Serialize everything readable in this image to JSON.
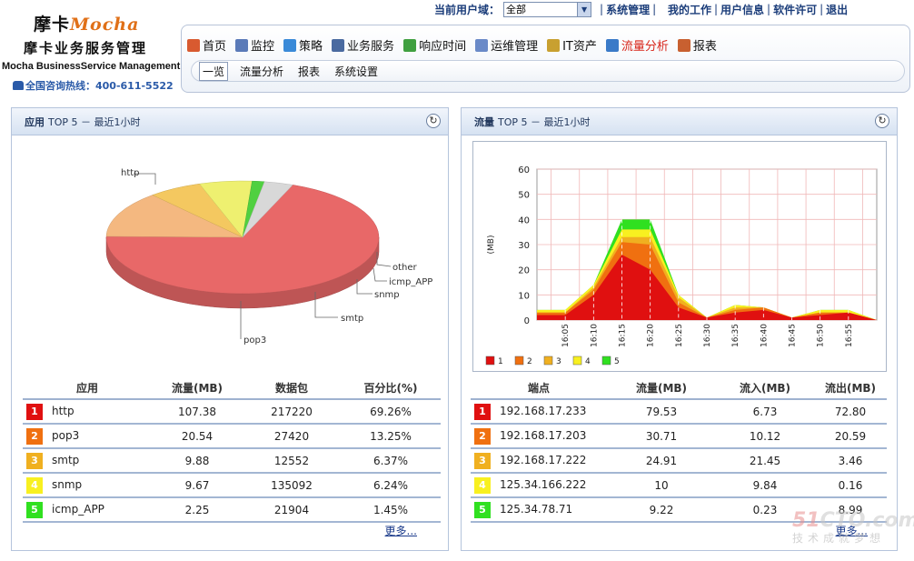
{
  "header": {
    "brand_cn": "摩卡",
    "brand_en": "Mocha",
    "product_cn": "摩卡业务服务管理",
    "product_en": "Mocha BusinessService Management",
    "hotline": "全国咨询热线：400-611-5522"
  },
  "userbar": {
    "domain_label": "当前用户域：",
    "domain_value": "全部",
    "links": [
      "系统管理",
      "我的工作",
      "用户信息",
      "软件许可",
      "退出"
    ]
  },
  "main_nav": [
    {
      "label": "首页",
      "icon": "home-icon"
    },
    {
      "label": "监控",
      "icon": "monitor-icon"
    },
    {
      "label": "策略",
      "icon": "policy-icon"
    },
    {
      "label": "业务服务",
      "icon": "service-icon"
    },
    {
      "label": "响应时间",
      "icon": "response-time-icon"
    },
    {
      "label": "运维管理",
      "icon": "ops-icon"
    },
    {
      "label": "IT资产",
      "icon": "asset-icon"
    },
    {
      "label": "流量分析",
      "icon": "traffic-icon",
      "active": true
    },
    {
      "label": "报表",
      "icon": "report-icon"
    }
  ],
  "sub_nav": [
    {
      "label": "一览",
      "active": true
    },
    {
      "label": "流量分析"
    },
    {
      "label": "报表"
    },
    {
      "label": "系统设置"
    }
  ],
  "app_panel": {
    "title_bold": "应用",
    "title_rest": "TOP 5 － 最近1小时",
    "columns": [
      "应用",
      "流量(MB)",
      "数据包",
      "百分比(%)"
    ],
    "rows": [
      {
        "rank": "1",
        "name": "http",
        "traffic": "107.38",
        "packets": "217220",
        "percent": "69.26%"
      },
      {
        "rank": "2",
        "name": "pop3",
        "traffic": "20.54",
        "packets": "27420",
        "percent": "13.25%"
      },
      {
        "rank": "3",
        "name": "smtp",
        "traffic": "9.88",
        "packets": "12552",
        "percent": "6.37%"
      },
      {
        "rank": "4",
        "name": "snmp",
        "traffic": "9.67",
        "packets": "135092",
        "percent": "6.24%"
      },
      {
        "rank": "5",
        "name": "icmp_APP",
        "traffic": "2.25",
        "packets": "21904",
        "percent": "1.45%"
      }
    ],
    "more": "更多..."
  },
  "traffic_panel": {
    "title_bold": "流量",
    "title_rest": "TOP 5 － 最近1小时",
    "columns": [
      "端点",
      "流量(MB)",
      "流入(MB)",
      "流出(MB)"
    ],
    "rows": [
      {
        "rank": "1",
        "endpoint": "192.168.17.233",
        "traffic": "79.53",
        "in": "6.73",
        "out": "72.80"
      },
      {
        "rank": "2",
        "endpoint": "192.168.17.203",
        "traffic": "30.71",
        "in": "10.12",
        "out": "20.59"
      },
      {
        "rank": "3",
        "endpoint": "192.168.17.222",
        "traffic": "24.91",
        "in": "21.45",
        "out": "3.46"
      },
      {
        "rank": "4",
        "endpoint": "125.34.166.222",
        "traffic": "10",
        "in": "9.84",
        "out": "0.16"
      },
      {
        "rank": "5",
        "endpoint": "125.34.78.71",
        "traffic": "9.22",
        "in": "0.23",
        "out": "8.99"
      }
    ],
    "more": "更多..."
  },
  "rank_colors": [
    "#e01010",
    "#f07010",
    "#f0b020",
    "#f8f020",
    "#30e020"
  ],
  "watermark": {
    "line1_a": "51",
    "line1_b": "CTO.com",
    "line2": "技术成就梦想"
  },
  "chart_data": [
    {
      "type": "pie",
      "labels": [
        "http",
        "pop3",
        "smtp",
        "snmp",
        "icmp_APP",
        "other"
      ],
      "values": [
        69.26,
        13.25,
        6.37,
        6.24,
        1.45,
        3.43
      ],
      "colors": [
        "#e86868",
        "#f4b880",
        "#f4c860",
        "#eef070",
        "#50d040",
        "#d8d8d8"
      ],
      "style": "3d"
    },
    {
      "type": "area",
      "stacked": true,
      "ylabel": "(MB)",
      "ylim": [
        0,
        60
      ],
      "yticks": [
        0,
        10,
        20,
        30,
        40,
        50,
        60
      ],
      "x": [
        "16:05",
        "16:10",
        "16:15",
        "16:20",
        "16:25",
        "16:30",
        "16:35",
        "16:40",
        "16:45",
        "16:50",
        "16:55"
      ],
      "legend": [
        "1",
        "2",
        "3",
        "4",
        "5"
      ],
      "legend_position": "bottom-left",
      "grid": true,
      "series": [
        {
          "name": "1",
          "color": "#e01010",
          "values": [
            2,
            10,
            26,
            20,
            5,
            1,
            3,
            4,
            1,
            2,
            3
          ]
        },
        {
          "name": "2",
          "color": "#f07010",
          "values": [
            1,
            2,
            5,
            10,
            2,
            0,
            1,
            1,
            0,
            1,
            0
          ]
        },
        {
          "name": "3",
          "color": "#f0b020",
          "values": [
            0,
            1,
            2,
            3,
            2,
            0,
            1,
            0,
            0,
            0,
            0
          ]
        },
        {
          "name": "4",
          "color": "#f8f020",
          "values": [
            1,
            1,
            3,
            3,
            1,
            0,
            1,
            0,
            0,
            1,
            1
          ]
        },
        {
          "name": "5",
          "color": "#30e020",
          "values": [
            0,
            0,
            4,
            4,
            0,
            0,
            0,
            0,
            0,
            0,
            0
          ]
        }
      ]
    }
  ]
}
